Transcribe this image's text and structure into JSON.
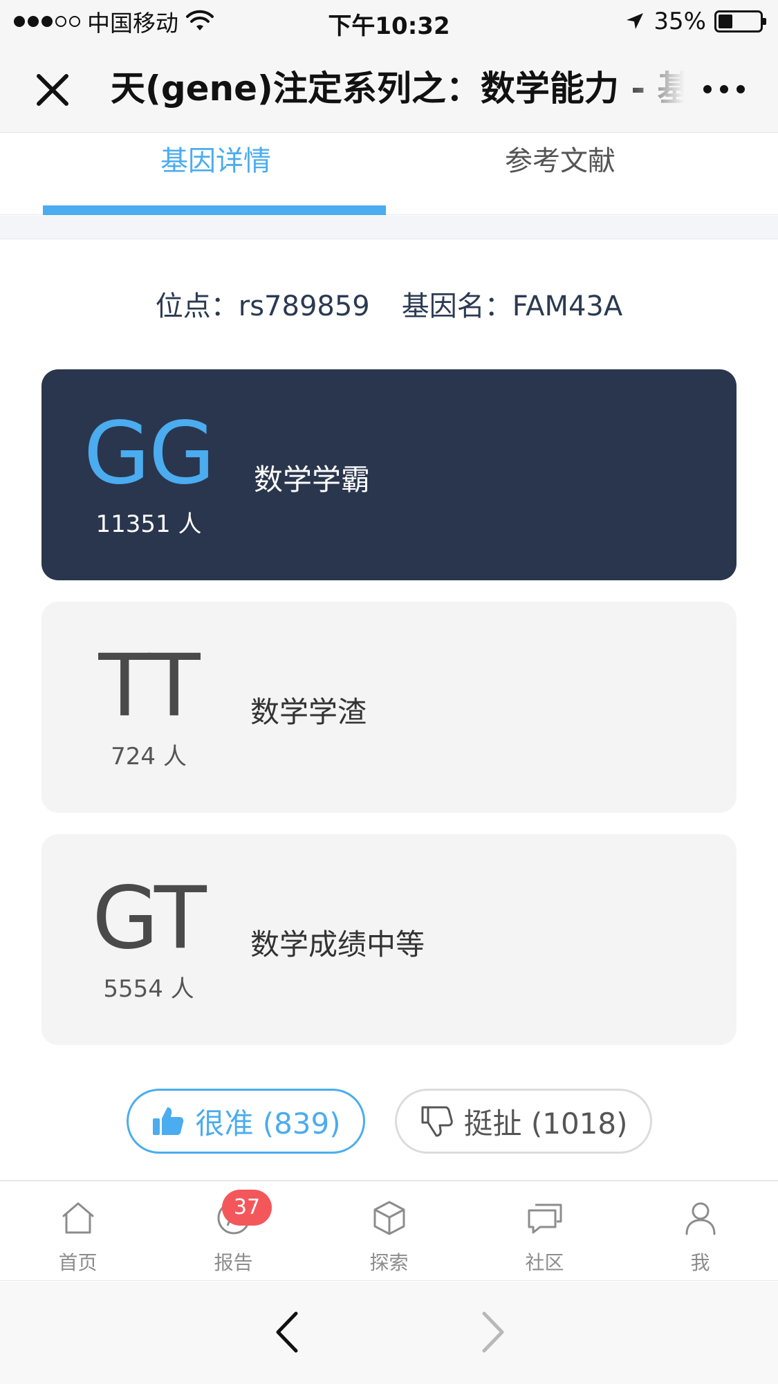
{
  "status_bar": {
    "carrier": "中国移动",
    "time": "下午10:32",
    "battery": "35%",
    "battery_level": 0.35,
    "signal_bars_filled": 3,
    "signal_bars_total": 5
  },
  "nav": {
    "title": "天(gene)注定系列之：数学能力 - 基因详情"
  },
  "tabs": [
    {
      "label": "基因详情",
      "active": true
    },
    {
      "label": "参考文献",
      "active": false
    }
  ],
  "locus": {
    "site_label": "位点：",
    "site_value": "rs789859",
    "gene_label": "基因名：",
    "gene_value": "FAM43A"
  },
  "genotypes": [
    {
      "code": "GG",
      "count": "11351 人",
      "description": "数学学霸",
      "highlighted": true
    },
    {
      "code": "TT",
      "count": "724 人",
      "description": "数学学渣",
      "highlighted": false
    },
    {
      "code": "GT",
      "count": "5554 人",
      "description": "数学成绩中等",
      "highlighted": false
    }
  ],
  "votes": {
    "up_label": "很准 (839)",
    "down_label": "挺扯 (1018)"
  },
  "tabbar": {
    "items": [
      {
        "label": "首页",
        "icon": "home-icon"
      },
      {
        "label": "报告",
        "icon": "report-icon",
        "badge": "37"
      },
      {
        "label": "探索",
        "icon": "cube-icon"
      },
      {
        "label": "社区",
        "icon": "chat-icon"
      },
      {
        "label": "我",
        "icon": "user-icon"
      }
    ]
  },
  "colors": {
    "accent": "#4bacef",
    "dark_card": "#2a364d",
    "light_card": "#f4f4f4",
    "badge": "#f4575b"
  }
}
